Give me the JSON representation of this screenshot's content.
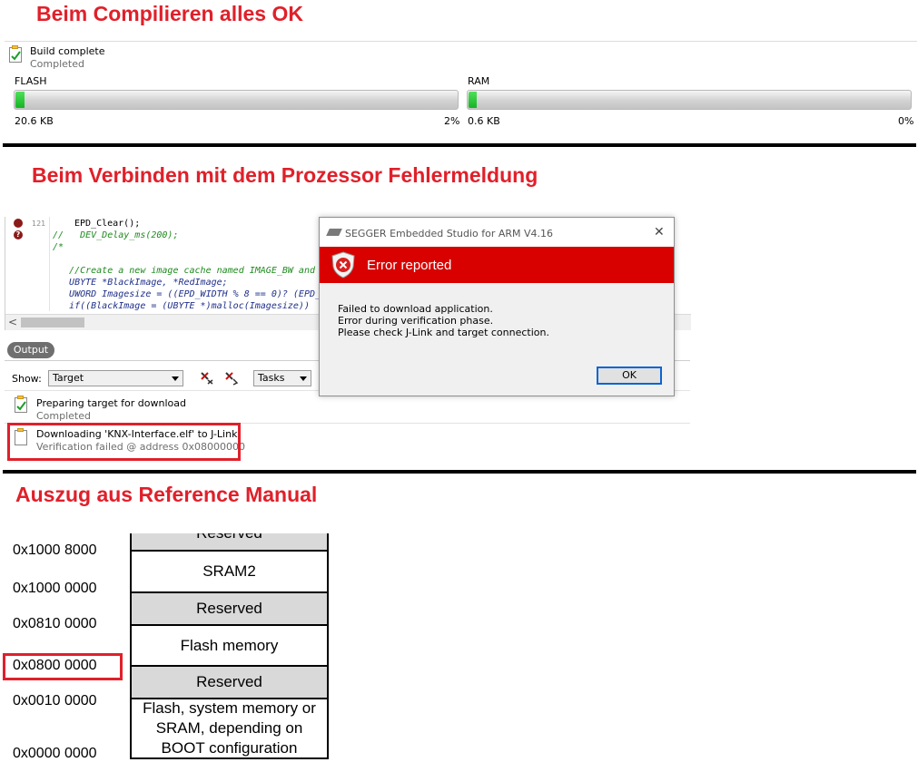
{
  "sections": {
    "compile_heading": "Beim Compilieren alles OK",
    "connect_heading": "Beim Verbinden mit dem Prozessor Fehlermeldung",
    "manual_heading": "Auszug aus Reference Manual"
  },
  "build": {
    "title": "Build complete",
    "status": "Completed",
    "flash": {
      "label": "FLASH",
      "size": "20.6 KB",
      "percent_text": "2%",
      "fill_fraction": 0.02
    },
    "ram": {
      "label": "RAM",
      "size": "0.6 KB",
      "percent_text": "0%",
      "fill_fraction": 0.0
    }
  },
  "editor": {
    "line_number": "121",
    "lines": [
      "EPD_Clear();",
      "//   DEV_Delay_ms(200);",
      "/*",
      "",
      "   //Create a new image cache named IMAGE_BW and",
      "   UBYTE *BlackImage, *RedImage;",
      "   UWORD Imagesize = ((EPD_WIDTH % 8 == 0)? (EPD_",
      "   if((BlackImage = (UBYTE *)malloc(Imagesize))"
    ],
    "scroll_left": "<"
  },
  "output": {
    "tab_label": "Output",
    "show_label": "Show:",
    "show_value": "Target",
    "tasks_value": "Tasks",
    "items": [
      {
        "title": "Preparing target for download",
        "status": "Completed"
      },
      {
        "title": "Downloading 'KNX-Interface.elf' to J-Link",
        "status": "Verification failed @ address 0x08000000"
      }
    ]
  },
  "dialog": {
    "title": "SEGGER Embedded Studio for ARM V4.16",
    "close": "✕",
    "header": "Error reported",
    "messages": [
      "Failed to download application.",
      "Error during verification phase.",
      "Please check J-Link and target connection."
    ],
    "ok_label": "OK"
  },
  "memory_map": {
    "addresses": [
      "0x1000 8000",
      "0x1000 0000",
      "0x0810 0000",
      "0x0800 0000",
      "0x0010 0000",
      "0x0000 0000"
    ],
    "regions": [
      {
        "label": "Reserved",
        "shaded": true
      },
      {
        "label": "SRAM2",
        "shaded": false
      },
      {
        "label": "Reserved",
        "shaded": true
      },
      {
        "label": "Flash memory",
        "shaded": false
      },
      {
        "label": "Reserved",
        "shaded": true
      },
      {
        "label": "Flash, system memory or SRAM, depending on BOOT configuration",
        "shaded": false
      }
    ]
  },
  "colors": {
    "heading_red": "#e0202a",
    "highlight_red": "#e0202a",
    "dialog_header_red": "#d90000",
    "progress_green": "#16b323",
    "region_shade": "#d9d9d9"
  }
}
